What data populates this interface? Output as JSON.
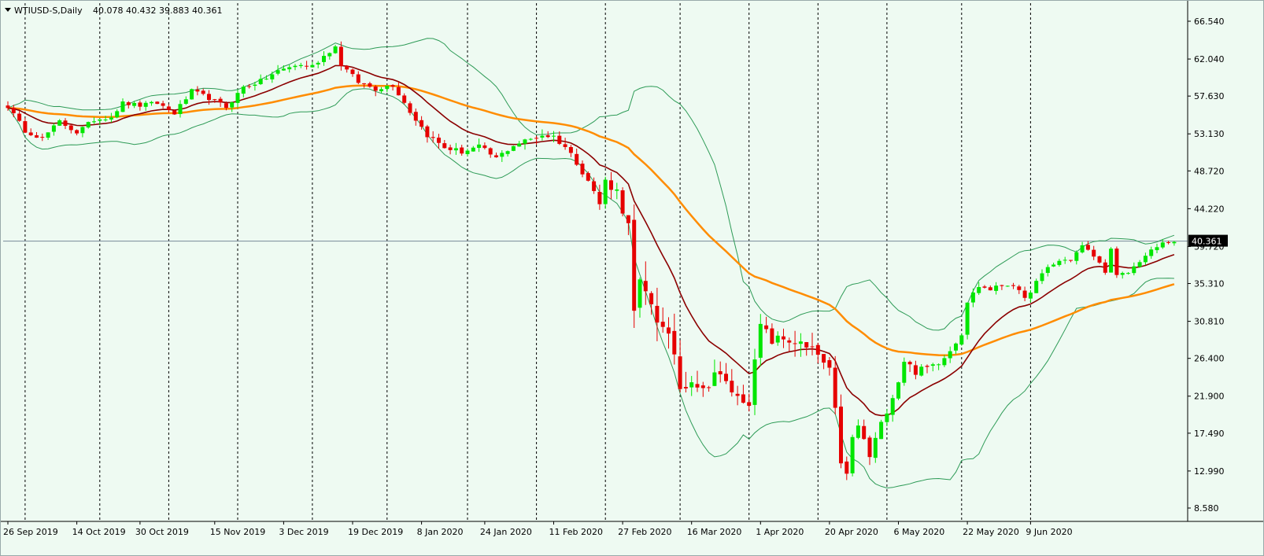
{
  "header": {
    "symbol": "WTIUSD-S,Daily",
    "ohlc": "40.078 40.432 39.883 40.361"
  },
  "current_price_label": "40.361",
  "chart_data": {
    "type": "candlestick",
    "y_ticks": [
      "66.540",
      "62.040",
      "57.630",
      "53.130",
      "48.720",
      "44.220",
      "39.720",
      "35.310",
      "30.810",
      "26.400",
      "21.900",
      "17.490",
      "12.990",
      "8.580"
    ],
    "ylim": [
      7.8,
      68.5
    ],
    "x_labels": [
      "26 Sep 2019",
      "14 Oct 2019",
      "30 Oct 2019",
      "15 Nov 2019",
      "3 Dec 2019",
      "19 Dec 2019",
      "8 Jan 2020",
      "24 Jan 2020",
      "11 Feb 2020",
      "27 Feb 2020",
      "16 Mar 2020",
      "1 Apr 2020",
      "20 Apr 2020",
      "6 May 2020",
      "22 May 2020",
      "9 Jun 2020"
    ],
    "x_label_bars": [
      0,
      12,
      23,
      36,
      48,
      60,
      72,
      83,
      95,
      107,
      119,
      131,
      143,
      155,
      167,
      178
    ],
    "period_separators": [
      3,
      16,
      28,
      40,
      53,
      66,
      80,
      92,
      104,
      117,
      129,
      141,
      153,
      166,
      178
    ],
    "current_price": 40.361,
    "close_anchors": [
      [
        0,
        56.4
      ],
      [
        3,
        53.5
      ],
      [
        6,
        52.6
      ],
      [
        9,
        54.6
      ],
      [
        12,
        53.3
      ],
      [
        15,
        54.8
      ],
      [
        18,
        55.2
      ],
      [
        20,
        56.8
      ],
      [
        23,
        56.5
      ],
      [
        26,
        56.8
      ],
      [
        29,
        55.6
      ],
      [
        32,
        58.2
      ],
      [
        35,
        57.4
      ],
      [
        38,
        56.3
      ],
      [
        41,
        58.7
      ],
      [
        44,
        59.4
      ],
      [
        47,
        60.6
      ],
      [
        50,
        61.3
      ],
      [
        53,
        61.2
      ],
      [
        56,
        63.0
      ],
      [
        57,
        63.5
      ],
      [
        58,
        61.4
      ],
      [
        61,
        59.3
      ],
      [
        64,
        58.5
      ],
      [
        67,
        59.0
      ],
      [
        70,
        55.8
      ],
      [
        73,
        53.0
      ],
      [
        76,
        51.5
      ],
      [
        79,
        51.0
      ],
      [
        82,
        51.6
      ],
      [
        85,
        50.2
      ],
      [
        88,
        51.8
      ],
      [
        91,
        52.5
      ],
      [
        93,
        53.0
      ],
      [
        95,
        52.8
      ],
      [
        97,
        51.6
      ],
      [
        99,
        49.8
      ],
      [
        101,
        47.6
      ],
      [
        103,
        44.8
      ],
      [
        104,
        47.5
      ],
      [
        106,
        46.3
      ],
      [
        108,
        42.0
      ],
      [
        109,
        31.5
      ],
      [
        110,
        34.8
      ],
      [
        112,
        33.2
      ],
      [
        114,
        29.6
      ],
      [
        116,
        27.2
      ],
      [
        117,
        22.9
      ],
      [
        119,
        24.2
      ],
      [
        121,
        22.4
      ],
      [
        123,
        24.8
      ],
      [
        125,
        23.4
      ],
      [
        127,
        21.7
      ],
      [
        129,
        21.3
      ],
      [
        130,
        25.8
      ],
      [
        131,
        30.3
      ],
      [
        133,
        28.5
      ],
      [
        135,
        28.7
      ],
      [
        137,
        28.4
      ],
      [
        139,
        27.5
      ],
      [
        141,
        26.8
      ],
      [
        143,
        24.6
      ],
      [
        144,
        19.9
      ],
      [
        145,
        14.3
      ],
      [
        146,
        12.3
      ],
      [
        147,
        16.8
      ],
      [
        148,
        18.4
      ],
      [
        150,
        14.7
      ],
      [
        151,
        16.7
      ],
      [
        153,
        20.3
      ],
      [
        155,
        23.7
      ],
      [
        156,
        26.2
      ],
      [
        158,
        24.8
      ],
      [
        160,
        25.3
      ],
      [
        162,
        26.0
      ],
      [
        164,
        27.4
      ],
      [
        166,
        29.4
      ],
      [
        167,
        33.2
      ],
      [
        169,
        35.0
      ],
      [
        171,
        34.6
      ],
      [
        173,
        35.1
      ],
      [
        175,
        35.2
      ],
      [
        177,
        33.4
      ],
      [
        179,
        35.5
      ],
      [
        181,
        37.2
      ],
      [
        183,
        38.0
      ],
      [
        185,
        38.2
      ],
      [
        187,
        39.8
      ],
      [
        189,
        38.6
      ],
      [
        191,
        36.8
      ],
      [
        192,
        39.3
      ],
      [
        193,
        36.2
      ],
      [
        195,
        36.6
      ],
      [
        197,
        38.0
      ],
      [
        199,
        39.2
      ],
      [
        201,
        40.1
      ],
      [
        203,
        40.36
      ]
    ],
    "volatility_anchors": [
      [
        0,
        0.6
      ],
      [
        55,
        0.7
      ],
      [
        98,
        0.9
      ],
      [
        107,
        1.4
      ],
      [
        109,
        3.0
      ],
      [
        128,
        1.4
      ],
      [
        143,
        2.0
      ],
      [
        152,
        1.2
      ],
      [
        175,
        0.6
      ],
      [
        203,
        0.5
      ]
    ],
    "ma_fast_period": 14,
    "ma_slow_period": 50,
    "bb_period": 20,
    "bb_deviation": 2,
    "colors": {
      "bull": "#00e600",
      "bear": "#e60000",
      "ma_fast": "#8b0000",
      "ma_slow": "#ff8c00",
      "bands": "#2e9b57",
      "background": "#eefaf2",
      "axis": "#000000",
      "price_line": "#778899"
    }
  }
}
